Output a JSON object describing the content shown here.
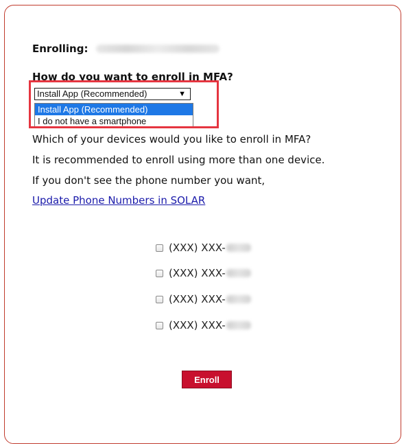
{
  "form": {
    "enrolling_label": "Enrolling:",
    "question": "How do you want to enroll in MFA?",
    "select": {
      "value": "Install App (Recommended)",
      "arrow_icon": "triangle-down-icon",
      "options": [
        "Install App (Recommended)",
        "I do not have a smartphone"
      ],
      "highlighted_option": 0
    },
    "instructions": [
      "Which of your devices would you like to enroll in MFA?",
      "It is recommended to enroll using more than one device.",
      "If you don't see the phone number you want,"
    ],
    "update_link": "Update Phone Numbers in SOLAR",
    "phones": [
      {
        "label": "(XXX) XXX-",
        "checked": false
      },
      {
        "label": "(XXX) XXX-",
        "checked": false
      },
      {
        "label": "(XXX) XXX-",
        "checked": false
      },
      {
        "label": "(XXX) XXX-",
        "checked": false
      }
    ],
    "enroll_button": "Enroll"
  },
  "colors": {
    "card_border": "#c0392b",
    "annotation_box": "#e53540",
    "selected_option_bg": "#1e78e6",
    "link": "#1a1aaa",
    "button_bg": "#c8102e"
  }
}
